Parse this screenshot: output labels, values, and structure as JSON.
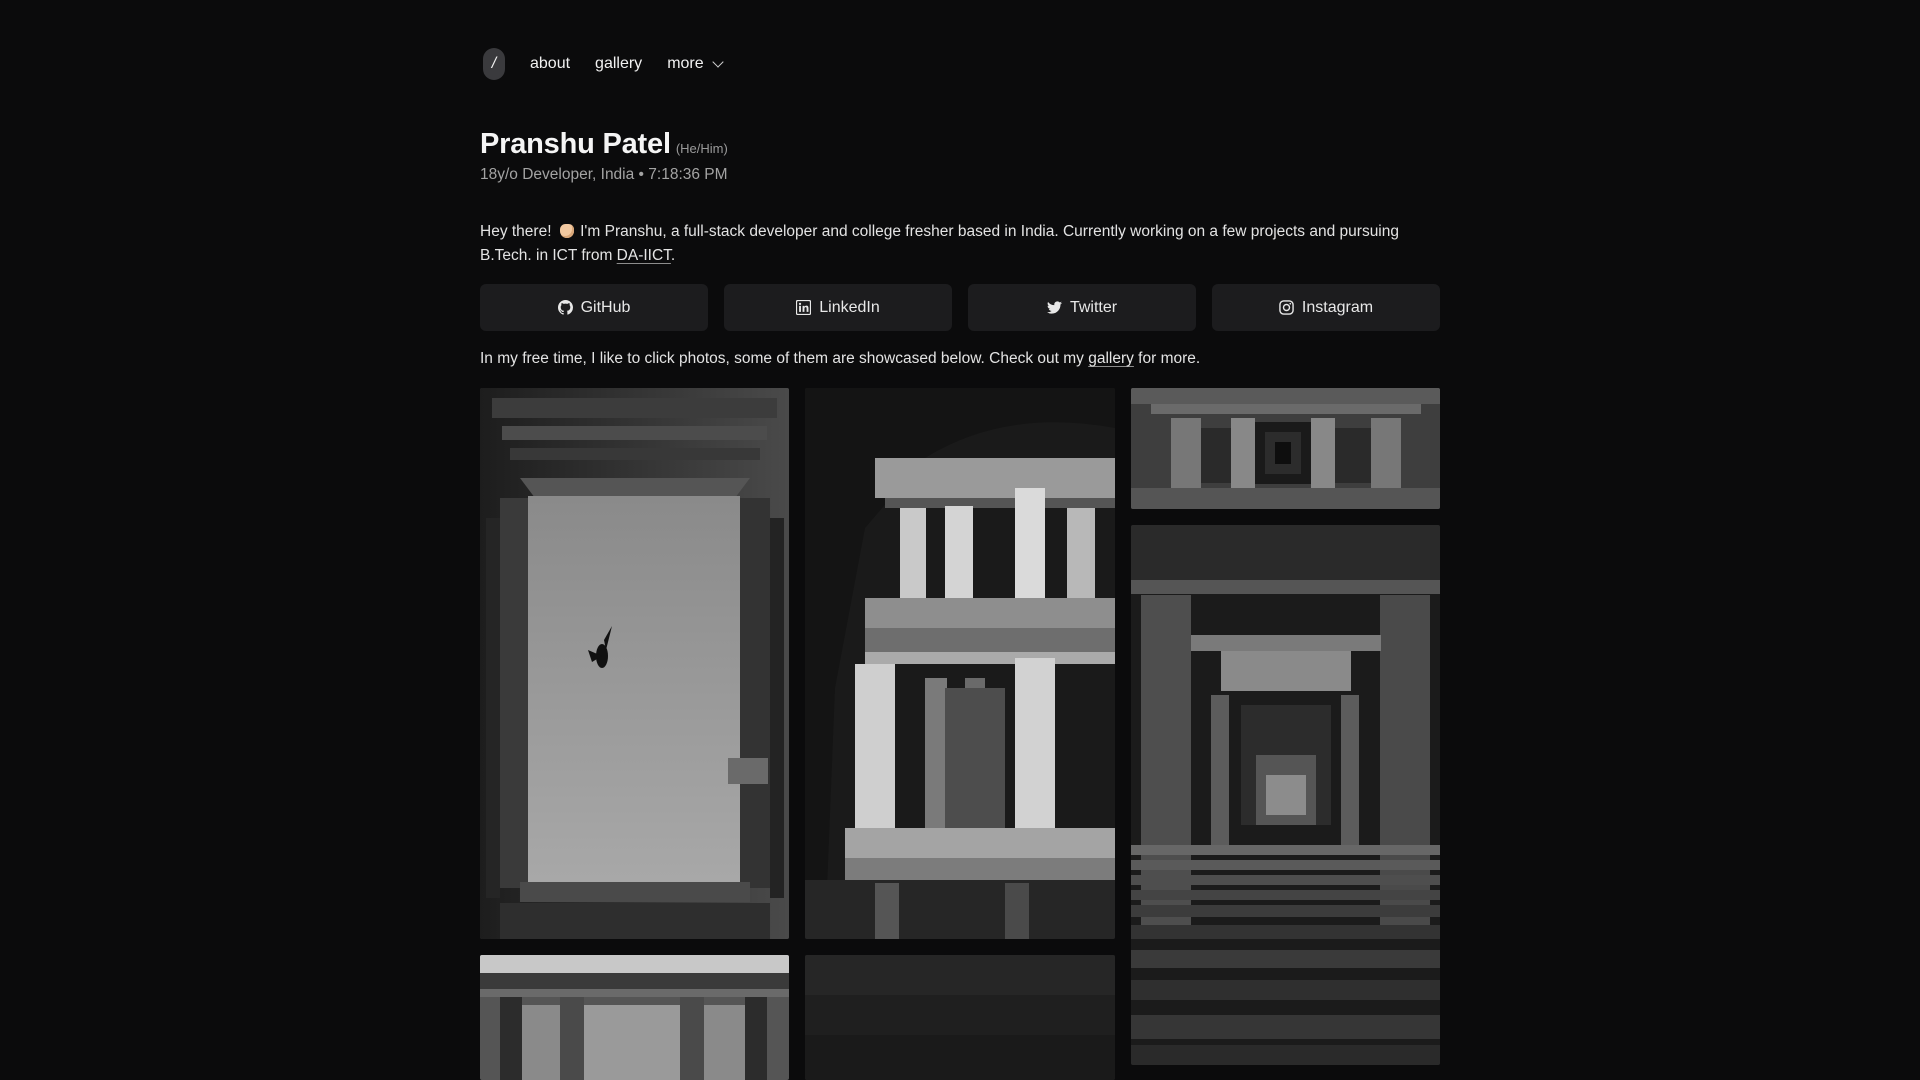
{
  "nav": {
    "home_label": "/",
    "items": [
      {
        "label": "about"
      },
      {
        "label": "gallery"
      },
      {
        "label": "more"
      }
    ]
  },
  "profile": {
    "name": "Pranshu Patel",
    "pronouns": "(He/Him)",
    "subtitle": "18y/o Developer, India • 7:18:36 PM"
  },
  "intro": {
    "part1": "Hey there! ",
    "part2": " I'm Pranshu, a full-stack developer and college fresher based in India. Currently working on a few projects and pursuing B.Tech. in ICT from ",
    "link": "DA-IICT",
    "part3": "."
  },
  "social": [
    {
      "label": "GitHub",
      "icon": "github-icon"
    },
    {
      "label": "LinkedIn",
      "icon": "linkedin-icon"
    },
    {
      "label": "Twitter",
      "icon": "twitter-icon"
    },
    {
      "label": "Instagram",
      "icon": "instagram-icon"
    }
  ],
  "freetime": {
    "part1": "In my free time, I like to click photos, some of them are showcased below. Check out my ",
    "link": "gallery",
    "part2": " for more."
  },
  "colors": {
    "background": "#0b0b0c",
    "button_bg": "#1c1c1e",
    "text": "#e6e6e6",
    "muted": "#a3a3a3"
  }
}
